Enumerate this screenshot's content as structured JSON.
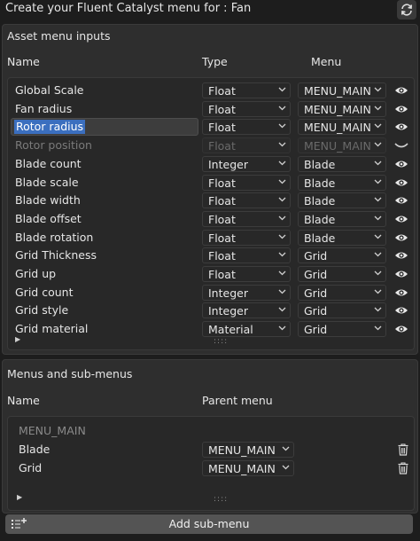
{
  "header": {
    "title": "Create your Fluent Catalyst menu for : Fan"
  },
  "asset_panel": {
    "title": "Asset menu inputs",
    "col_name": "Name",
    "col_type": "Type",
    "col_menu": "Menu",
    "rows": [
      {
        "name": "Global Scale",
        "type": "Float",
        "menu": "MENU_MAIN"
      },
      {
        "name": "Fan radius",
        "type": "Float",
        "menu": "MENU_MAIN"
      },
      {
        "name": "Rotor radius",
        "type": "Float",
        "menu": "MENU_MAIN"
      },
      {
        "name": "Rotor position",
        "type": "Float",
        "menu": "MENU_MAIN"
      },
      {
        "name": "Blade count",
        "type": "Integer",
        "menu": "Blade"
      },
      {
        "name": "Blade scale",
        "type": "Float",
        "menu": "Blade"
      },
      {
        "name": "Blade width",
        "type": "Float",
        "menu": "Blade"
      },
      {
        "name": "Blade offset",
        "type": "Float",
        "menu": "Blade"
      },
      {
        "name": "Blade rotation",
        "type": "Float",
        "menu": "Blade"
      },
      {
        "name": "Grid Thickness",
        "type": "Float",
        "menu": "Grid"
      },
      {
        "name": "Grid up",
        "type": "Float",
        "menu": "Grid"
      },
      {
        "name": "Grid count",
        "type": "Integer",
        "menu": "Grid"
      },
      {
        "name": "Grid style",
        "type": "Integer",
        "menu": "Grid"
      },
      {
        "name": "Grid material",
        "type": "Material",
        "menu": "Grid"
      }
    ]
  },
  "menus_panel": {
    "title": "Menus and sub-menus",
    "col_name": "Name",
    "col_parent": "Parent menu",
    "root_label": "MENU_MAIN",
    "rows": [
      {
        "name": "Blade",
        "parent": "MENU_MAIN"
      },
      {
        "name": "Grid",
        "parent": "MENU_MAIN"
      }
    ]
  },
  "grip_glyph": "::::",
  "expand_glyph": "▶",
  "add_submenu_label": "Add sub-menu"
}
